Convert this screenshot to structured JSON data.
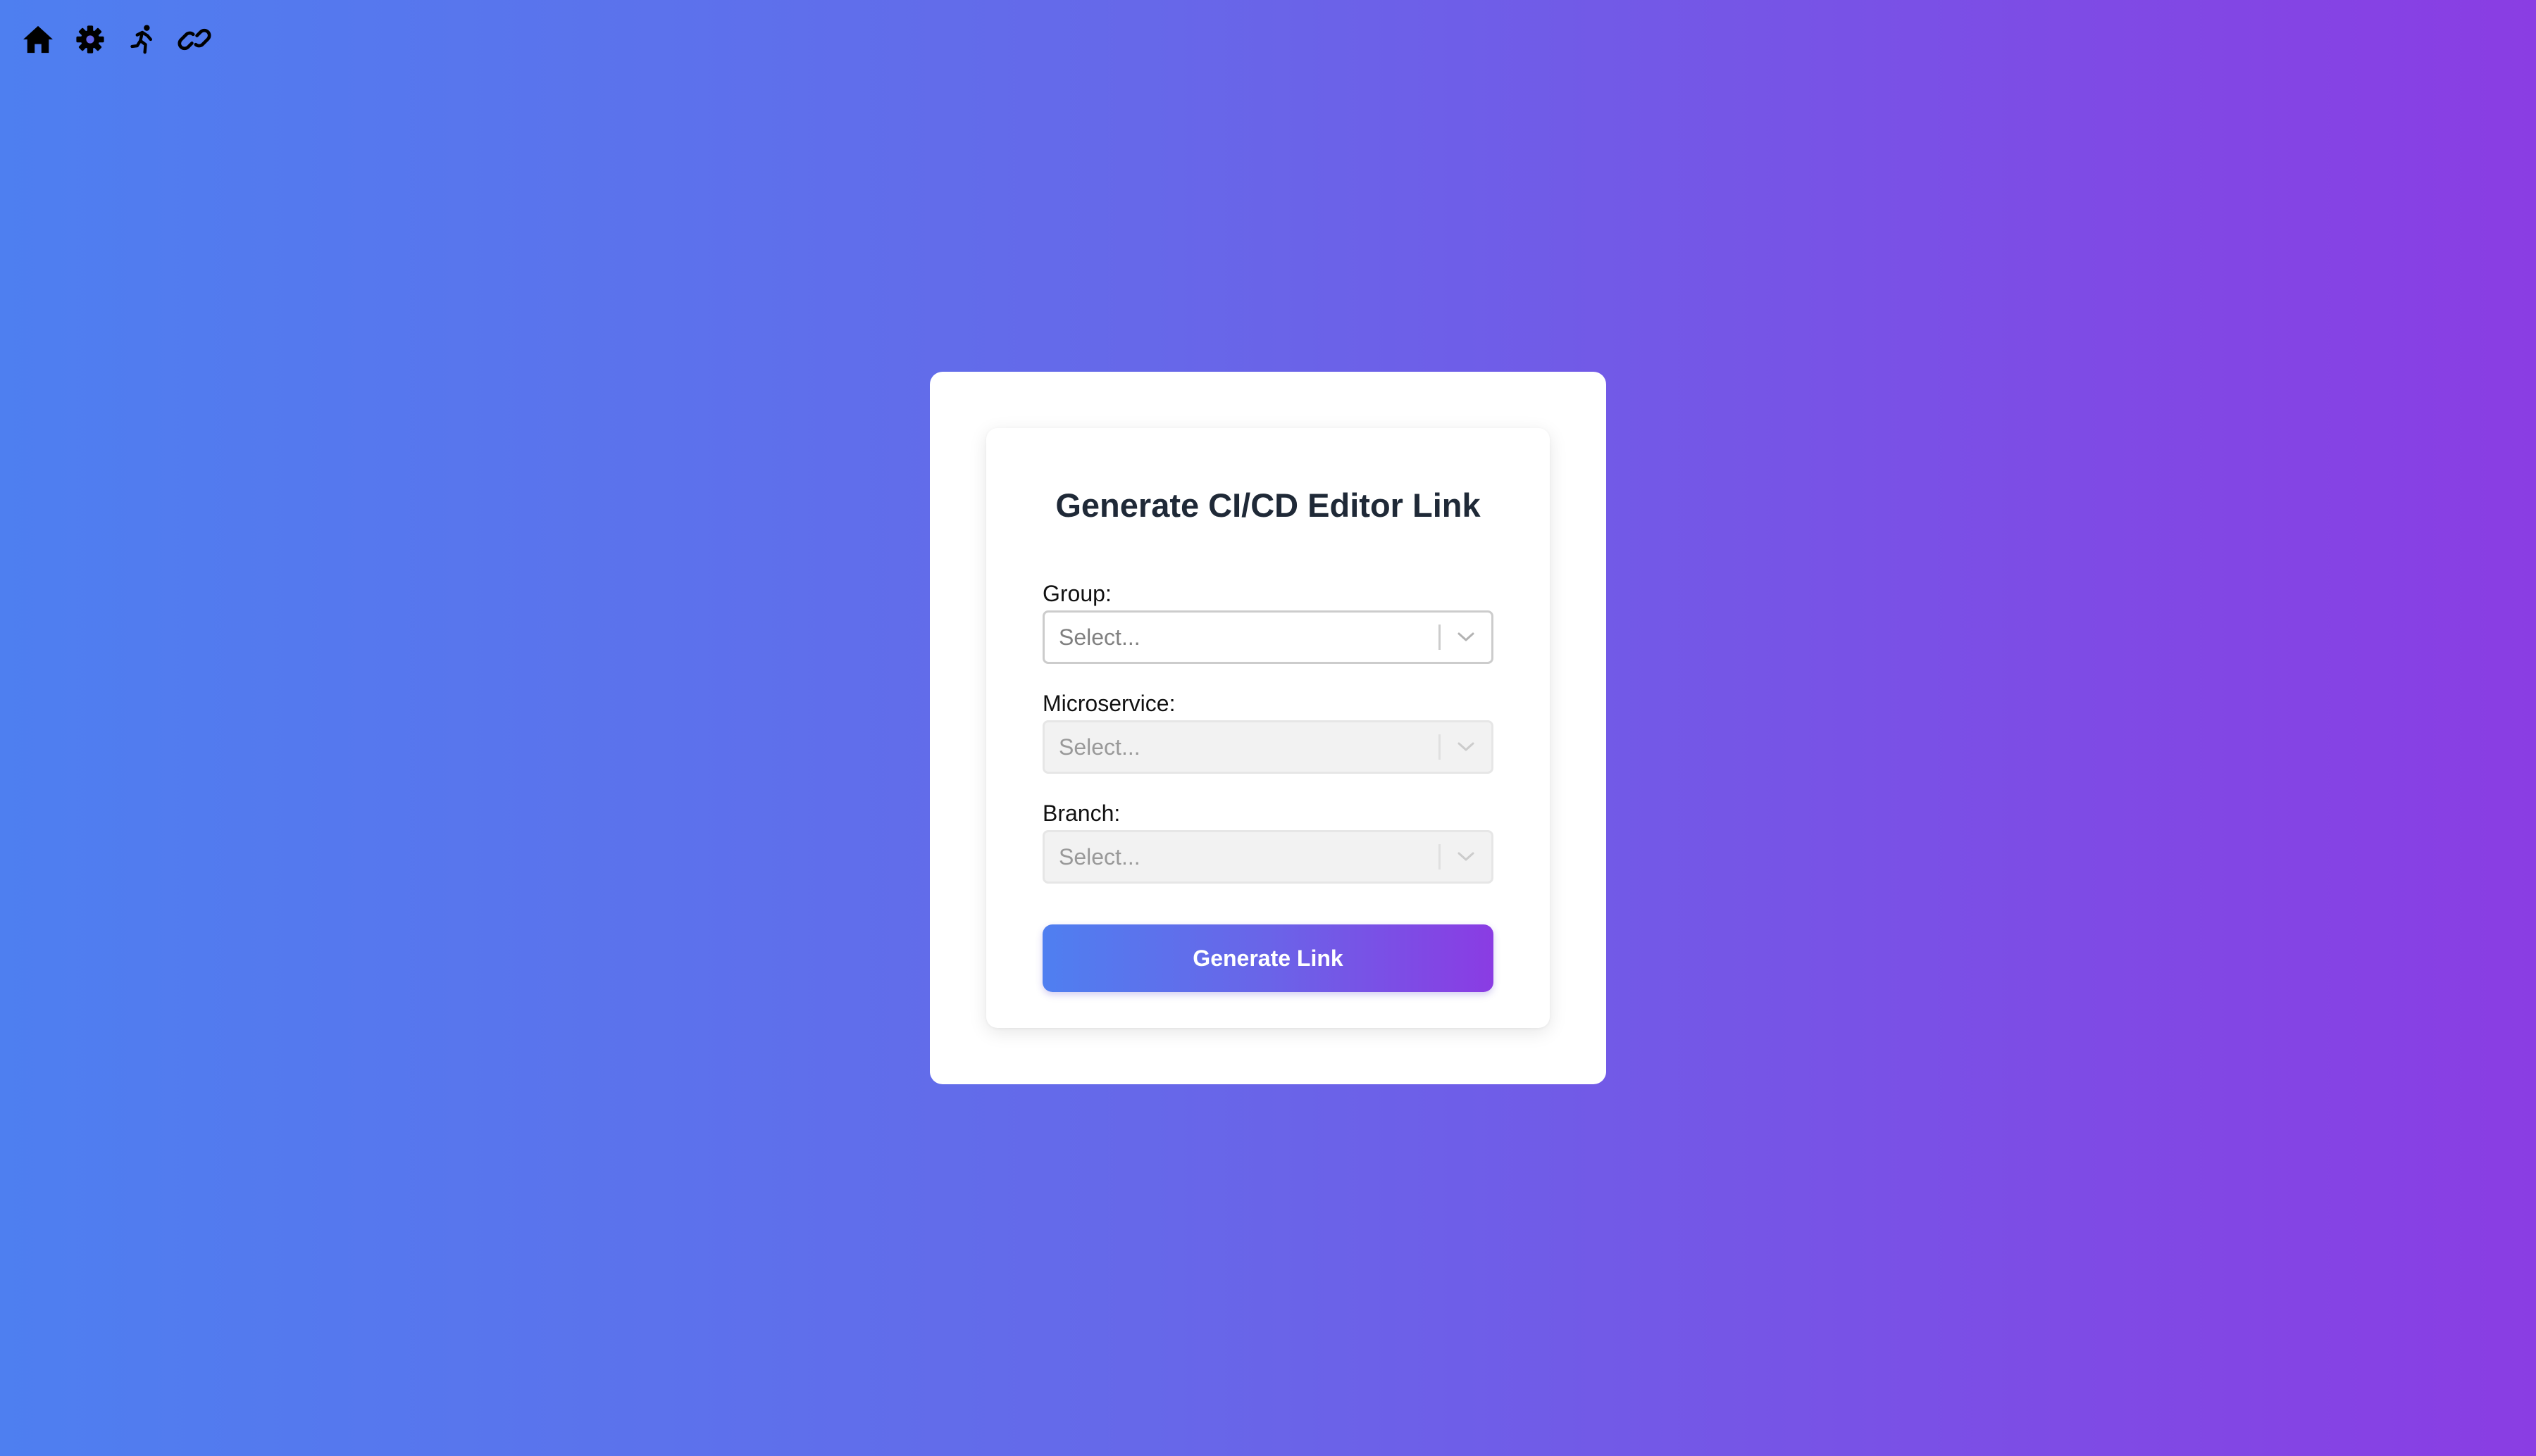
{
  "nav": {
    "icons": [
      "home-icon",
      "gear-icon",
      "running-person-icon",
      "link-icon"
    ]
  },
  "form": {
    "title": "Generate CI/CD Editor Link",
    "group": {
      "label": "Group:",
      "placeholder": "Select...",
      "disabled": false
    },
    "microservice": {
      "label": "Microservice:",
      "placeholder": "Select...",
      "disabled": true
    },
    "branch": {
      "label": "Branch:",
      "placeholder": "Select...",
      "disabled": true
    },
    "button_label": "Generate Link"
  },
  "colors": {
    "gradient_start": "#4e7ff0",
    "gradient_end": "#8a3de3",
    "title_text": "#1f2937",
    "card_background": "#ffffff"
  }
}
